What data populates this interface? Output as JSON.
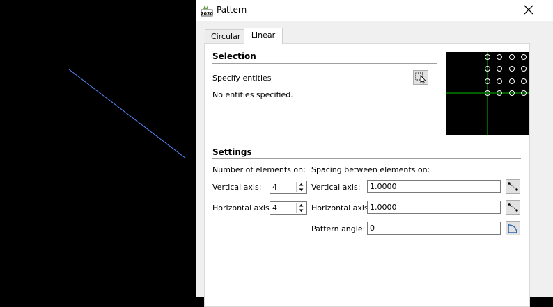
{
  "window": {
    "title": "Pattern",
    "app_icon_label": "2020"
  },
  "tabs": [
    {
      "label": "Circular"
    },
    {
      "label": "Linear"
    }
  ],
  "selection": {
    "title": "Selection",
    "specify_label": "Specify entities",
    "status": "No entities specified."
  },
  "settings": {
    "title": "Settings",
    "elements_heading": "Number of elements on:",
    "spacing_heading": "Spacing between elements on:",
    "vertical_axis_label": "Vertical axis:",
    "horizontal_axis_label": "Horizontal axis:",
    "vertical_count": "4",
    "horizontal_count": "4",
    "spacing_vertical_label": "Vertical axis:",
    "spacing_horizontal_label": "Horizontal axis:",
    "spacing_vertical": "1.0000",
    "spacing_horizontal": "1.0000",
    "pattern_angle_label": "Pattern angle:",
    "pattern_angle": "0"
  },
  "colors": {
    "canvas_line": "#5b87ff",
    "preview_grid": "#00c000",
    "accent": "#1e5aa8"
  }
}
